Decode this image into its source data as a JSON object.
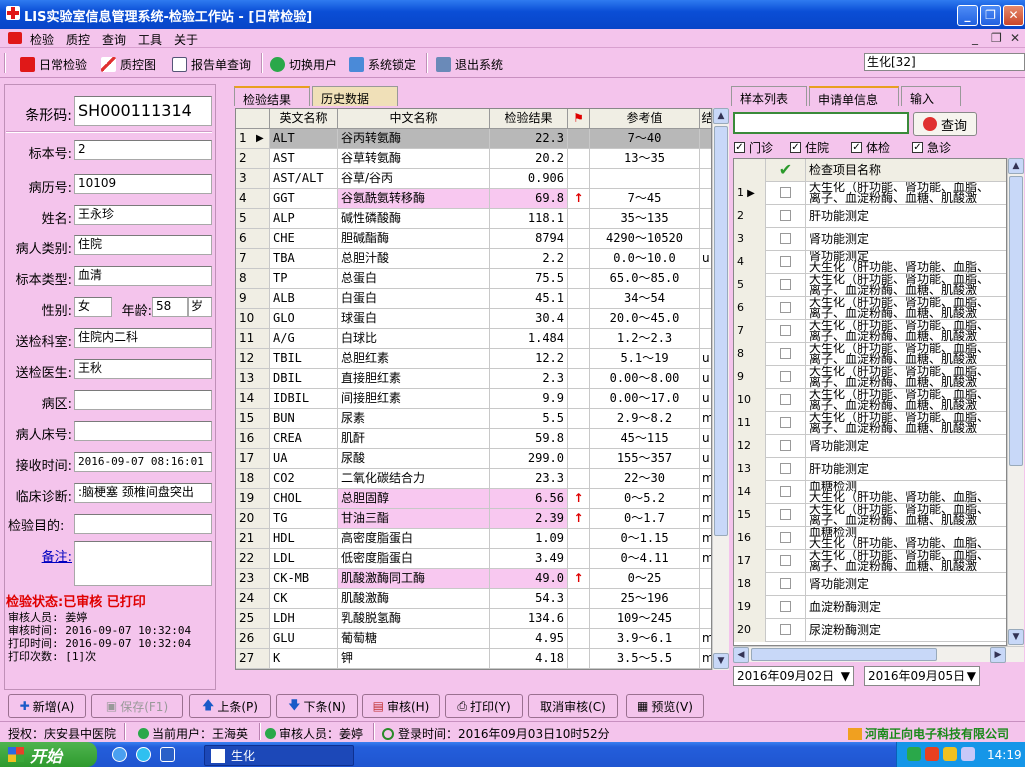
{
  "window": {
    "title": "LIS实验室信息管理系统-检验工作站 - [日常检验]"
  },
  "menu": [
    "检验",
    "质控",
    "查询",
    "工具",
    "关于"
  ],
  "toolbar": {
    "daily_check": "日常检验",
    "qc_chart": "质控图",
    "report_query": "报告单查询",
    "switch_user": "切换用户",
    "system_lock": "系统锁定",
    "exit_system": "退出系统",
    "business_field": "生化[32]"
  },
  "specimen": {
    "barcode_label": "条形码:",
    "barcode": "SH000111314",
    "specimen_no_label": "标本号:",
    "specimen_no": "2",
    "record_no_label": "病历号:",
    "record_no": "10109",
    "name_label": "姓名:",
    "name": "王永珍",
    "patient_type_label": "病人类别:",
    "patient_type": "住院",
    "specimen_type_label": "标本类型:",
    "specimen_type": "血清",
    "gender_label": "性别:",
    "gender": "女",
    "age_label": "年龄:",
    "age": "58",
    "age_unit": "岁",
    "dept_label": "送检科室:",
    "dept": "住院内二科",
    "doctor_label": "送检医生:",
    "doctor": "王秋",
    "ward_label": "病区:",
    "ward": "",
    "bed_label": "病人床号:",
    "bed": "",
    "receive_time_label": "接收时间:",
    "receive_time": "2016-09-07 08:16:01",
    "diagnosis_label": "临床诊断:",
    "diagnosis": ":脑梗塞 颈椎间盘突出",
    "purpose_label": "检验目的:",
    "purpose": "",
    "remark_label": "备注:",
    "remark": ""
  },
  "status": {
    "title": "检验状态:已审核  已打印",
    "reviewer": "审核人员: 姜婷",
    "review_time": "审核时间: 2016-09-07 10:32:04",
    "print_time": "打印时间: 2016-09-07 10:32:04",
    "print_count": "打印次数: [1]次"
  },
  "tabs": {
    "results": "检验结果",
    "history": "历史数据"
  },
  "columns": {
    "en": "英文名称",
    "cn": "中文名称",
    "result": "检验结果",
    "ref": "参考值",
    "extra": "结"
  },
  "results": [
    {
      "n": "1",
      "en": "ALT",
      "cn": "谷丙转氨酶",
      "r": "22.3",
      "f": "",
      "ref": "7～40",
      "x": ""
    },
    {
      "n": "2",
      "en": "AST",
      "cn": "谷草转氨酶",
      "r": "20.2",
      "f": "",
      "ref": "13～35",
      "x": ""
    },
    {
      "n": "3",
      "en": "AST/ALT",
      "cn": "谷草/谷丙",
      "r": "0.906",
      "f": "",
      "ref": "",
      "x": ""
    },
    {
      "n": "4",
      "en": "GGT",
      "cn": "谷氨酰氨转移酶",
      "r": "69.8",
      "f": "↑",
      "ref": "7～45",
      "x": ""
    },
    {
      "n": "5",
      "en": "ALP",
      "cn": "碱性磷酸酶",
      "r": "118.1",
      "f": "",
      "ref": "35～135",
      "x": ""
    },
    {
      "n": "6",
      "en": "CHE",
      "cn": "胆碱酯酶",
      "r": "8794",
      "f": "",
      "ref": "4290～10520",
      "x": ""
    },
    {
      "n": "7",
      "en": "TBA",
      "cn": "总胆汁酸",
      "r": "2.2",
      "f": "",
      "ref": "0.0～10.0",
      "x": "u"
    },
    {
      "n": "8",
      "en": "TP",
      "cn": "总蛋白",
      "r": "75.5",
      "f": "",
      "ref": "65.0～85.0",
      "x": ""
    },
    {
      "n": "9",
      "en": "ALB",
      "cn": "白蛋白",
      "r": "45.1",
      "f": "",
      "ref": "34～54",
      "x": ""
    },
    {
      "n": "10",
      "en": "GLO",
      "cn": "球蛋白",
      "r": "30.4",
      "f": "",
      "ref": "20.0～45.0",
      "x": ""
    },
    {
      "n": "11",
      "en": "A/G",
      "cn": "白球比",
      "r": "1.484",
      "f": "",
      "ref": "1.2～2.3",
      "x": ""
    },
    {
      "n": "12",
      "en": "TBIL",
      "cn": "总胆红素",
      "r": "12.2",
      "f": "",
      "ref": "5.1～19",
      "x": "u"
    },
    {
      "n": "13",
      "en": "DBIL",
      "cn": "直接胆红素",
      "r": "2.3",
      "f": "",
      "ref": "0.00～8.00",
      "x": "u"
    },
    {
      "n": "14",
      "en": "IDBIL",
      "cn": "间接胆红素",
      "r": "9.9",
      "f": "",
      "ref": "0.00～17.0",
      "x": "u"
    },
    {
      "n": "15",
      "en": "BUN",
      "cn": "尿素",
      "r": "5.5",
      "f": "",
      "ref": "2.9～8.2",
      "x": "m"
    },
    {
      "n": "16",
      "en": "CREA",
      "cn": "肌酐",
      "r": "59.8",
      "f": "",
      "ref": "45～115",
      "x": "u"
    },
    {
      "n": "17",
      "en": "UA",
      "cn": "尿酸",
      "r": "299.0",
      "f": "",
      "ref": "155～357",
      "x": "u"
    },
    {
      "n": "18",
      "en": "CO2",
      "cn": "二氧化碳结合力",
      "r": "23.3",
      "f": "",
      "ref": "22～30",
      "x": "m"
    },
    {
      "n": "19",
      "en": "CHOL",
      "cn": "总胆固醇",
      "r": "6.56",
      "f": "↑",
      "ref": "0～5.2",
      "x": "m"
    },
    {
      "n": "20",
      "en": "TG",
      "cn": "甘油三酯",
      "r": "2.39",
      "f": "↑",
      "ref": "0～1.7",
      "x": "m"
    },
    {
      "n": "21",
      "en": "HDL",
      "cn": "高密度脂蛋白",
      "r": "1.09",
      "f": "",
      "ref": "0～1.15",
      "x": "m"
    },
    {
      "n": "22",
      "en": "LDL",
      "cn": "低密度脂蛋白",
      "r": "3.49",
      "f": "",
      "ref": "0～4.11",
      "x": "m"
    },
    {
      "n": "23",
      "en": "CK-MB",
      "cn": "肌酸激酶同工酶",
      "r": "49.0",
      "f": "↑",
      "ref": "0～25",
      "x": ""
    },
    {
      "n": "24",
      "en": "CK",
      "cn": "肌酸激酶",
      "r": "54.3",
      "f": "",
      "ref": "25～196",
      "x": ""
    },
    {
      "n": "25",
      "en": "LDH",
      "cn": "乳酸脱氢酶",
      "r": "134.6",
      "f": "",
      "ref": "109～245",
      "x": ""
    },
    {
      "n": "26",
      "en": "GLU",
      "cn": "葡萄糖",
      "r": "4.95",
      "f": "",
      "ref": "3.9～6.1",
      "x": "m"
    },
    {
      "n": "27",
      "en": "K",
      "cn": "钾",
      "r": "4.18",
      "f": "",
      "ref": "3.5～5.5",
      "x": "m"
    }
  ],
  "right_tabs": {
    "sample_list": "样本列表",
    "request_info": "申请单信息",
    "input": "输入"
  },
  "search": {
    "button": "查询",
    "value": ""
  },
  "filters": {
    "outpatient": "门诊",
    "inpatient": "住院",
    "physical": "体检",
    "emergency": "急诊"
  },
  "request_header": "检查项目名称",
  "requests": [
    {
      "n": "1",
      "l1": "大生化（肝功能、肾功能、血脂、",
      "l2": "离子、血淀粉酶、血糖、肌酸激"
    },
    {
      "n": "2",
      "l1": "肝功能测定",
      "l2": ""
    },
    {
      "n": "3",
      "l1": "肾功能测定",
      "l2": ""
    },
    {
      "n": "4",
      "l1": "肾功能测定",
      "l2": "大生化（肝功能、肾功能、血脂、"
    },
    {
      "n": "5",
      "l1": "大生化（肝功能、肾功能、血脂、",
      "l2": "离子、血淀粉酶、血糖、肌酸激"
    },
    {
      "n": "6",
      "l1": "大生化（肝功能、肾功能、血脂、",
      "l2": "离子、血淀粉酶、血糖、肌酸激"
    },
    {
      "n": "7",
      "l1": "大生化（肝功能、肾功能、血脂、",
      "l2": "离子、血淀粉酶、血糖、肌酸激"
    },
    {
      "n": "8",
      "l1": "大生化（肝功能、肾功能、血脂、",
      "l2": "离子、血淀粉酶、血糖、肌酸激"
    },
    {
      "n": "9",
      "l1": "大生化（肝功能、肾功能、血脂、",
      "l2": "离子、血淀粉酶、血糖、肌酸激"
    },
    {
      "n": "10",
      "l1": "大生化（肝功能、肾功能、血脂、",
      "l2": "离子、血淀粉酶、血糖、肌酸激"
    },
    {
      "n": "11",
      "l1": "大生化（肝功能、肾功能、血脂、",
      "l2": "离子、血淀粉酶、血糖、肌酸激"
    },
    {
      "n": "12",
      "l1": "肾功能测定",
      "l2": ""
    },
    {
      "n": "13",
      "l1": "肝功能测定",
      "l2": ""
    },
    {
      "n": "14",
      "l1": "血糖检测",
      "l2": "大生化（肝功能、肾功能、血脂、"
    },
    {
      "n": "15",
      "l1": "大生化（肝功能、肾功能、血脂、",
      "l2": "离子、血淀粉酶、血糖、肌酸激"
    },
    {
      "n": "16",
      "l1": "血糖检测",
      "l2": "大生化（肝功能、肾功能、血脂、"
    },
    {
      "n": "17",
      "l1": "大生化（肝功能、肾功能、血脂、",
      "l2": "离子、血淀粉酶、血糖、肌酸激"
    },
    {
      "n": "18",
      "l1": "肾功能测定",
      "l2": ""
    },
    {
      "n": "19",
      "l1": "血淀粉酶测定",
      "l2": ""
    },
    {
      "n": "20",
      "l1": "尿淀粉酶测定",
      "l2": ""
    }
  ],
  "dates": {
    "from": "2016年09月02日",
    "to": "2016年09月05日"
  },
  "buttons": {
    "add": "新增(A)",
    "save": "保存(F1)",
    "prev": "上条(P)",
    "next": "下条(N)",
    "review": "审核(H)",
    "print": "打印(Y)",
    "cancel_review": "取消审核(C)",
    "preview": "预览(V)"
  },
  "statusbar": {
    "auth": "授权：庆安县中医院",
    "current_user": "当前用户：王海英",
    "reviewer": "审核人员：姜婷",
    "login_time": "登录时间：2016年09月03日10时52分",
    "company": "河南正向电子科技有限公司"
  },
  "taskbar": {
    "start": "开始",
    "app": "生化",
    "time": "14:19"
  },
  "colors": {
    "accent_red": "#e00000",
    "background": "#f4c4ec",
    "title_blue": "#0a4ed6"
  }
}
